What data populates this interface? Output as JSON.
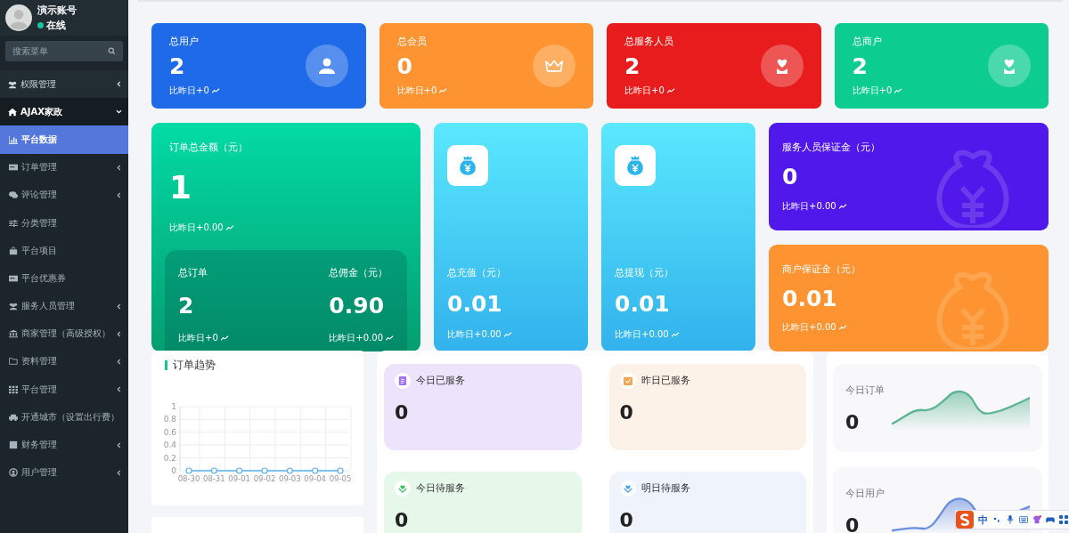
{
  "profile": {
    "name": "演示账号",
    "status": "在线",
    "online": true
  },
  "search": {
    "placeholder": "搜索菜单"
  },
  "menu": [
    {
      "label": "权限管理",
      "expanded": false
    },
    {
      "label": "AJAX家政",
      "expanded": true,
      "children": [
        {
          "label": "平台数据",
          "kind": "link",
          "selected": true
        },
        {
          "label": "订单管理",
          "kind": "group",
          "selected": false
        },
        {
          "label": "评论管理",
          "kind": "group",
          "selected": false
        },
        {
          "label": "分类管理",
          "kind": "link",
          "selected": false
        },
        {
          "label": "平台项目",
          "kind": "link",
          "selected": false
        },
        {
          "label": "平台优惠券",
          "kind": "link",
          "selected": false
        },
        {
          "label": "服务人员管理",
          "kind": "group",
          "selected": false
        },
        {
          "label": "商家管理（高级授权）",
          "kind": "group",
          "selected": false
        },
        {
          "label": "资料管理",
          "kind": "group",
          "selected": false
        },
        {
          "label": "平台管理",
          "kind": "group",
          "selected": false
        },
        {
          "label": "开通城市（设置出行费）",
          "kind": "link",
          "selected": false
        },
        {
          "label": "财务管理",
          "kind": "group",
          "selected": false
        },
        {
          "label": "用户管理",
          "kind": "group",
          "selected": false
        }
      ]
    }
  ],
  "stat_cards": [
    {
      "title": "总用户",
      "value": "2",
      "delta": "比昨日+0",
      "color": "#1e6ae8"
    },
    {
      "title": "总会员",
      "value": "0",
      "delta": "比昨日+0",
      "color": "#fd9431"
    },
    {
      "title": "总服务人员",
      "value": "2",
      "delta": "比昨日+0",
      "color": "#e81c1c"
    },
    {
      "title": "总商户",
      "value": "2",
      "delta": "比昨日+0",
      "color": "#0ccc8f"
    }
  ],
  "order_total": {
    "title": "订单总金额（元）",
    "value": "1",
    "delta": "比昨日+0.00",
    "orders": {
      "title": "总订单",
      "value": "2",
      "delta": "比昨日+0"
    },
    "commission": {
      "title": "总佣金（元）",
      "value": "0.90",
      "delta": "比昨日+0.00"
    }
  },
  "money_cards": [
    {
      "title": "总充值（元）",
      "value": "0.01",
      "delta": "比昨日+0.00"
    },
    {
      "title": "总提现（元）",
      "value": "0.01",
      "delta": "比昨日+0.00"
    }
  ],
  "deposit_cards": [
    {
      "title": "服务人员保证金（元）",
      "value": "0",
      "delta": "比昨日+0.00",
      "color": "#5018ea"
    },
    {
      "title": "商户保证金（元）",
      "value": "0.01",
      "delta": "比昨日+0.00",
      "color": "#fd9431"
    }
  ],
  "order_trend": {
    "title": "订单趋势",
    "chart_data": {
      "type": "line",
      "categories": [
        "08-30",
        "08-31",
        "09-01",
        "09-02",
        "09-03",
        "09-04",
        "09-05"
      ],
      "series": [
        {
          "color": "#5ab1ef",
          "values": [
            0,
            0,
            0,
            0,
            0,
            0,
            0
          ]
        }
      ],
      "ylim": [
        0,
        1
      ],
      "yticks": [
        0,
        0.2,
        0.4,
        0.6,
        0.8,
        1
      ],
      "grid": true,
      "marker": true
    }
  },
  "services": [
    {
      "title": "今日已服务",
      "value": "0",
      "color": "#ede3fd"
    },
    {
      "title": "昨日已服务",
      "value": "0",
      "color": "#fdf2e8"
    },
    {
      "title": "今日待服务",
      "value": "0",
      "color": "#e6f8ea"
    },
    {
      "title": "明日待服务",
      "value": "0",
      "color": "#eef3fc"
    }
  ],
  "today": [
    {
      "title": "今日订单",
      "value": "0",
      "color": "#5bb592"
    },
    {
      "title": "今日用户",
      "value": "0",
      "color": "#6b8fe0"
    }
  ],
  "ime_toolbar": {
    "mode": "中"
  }
}
